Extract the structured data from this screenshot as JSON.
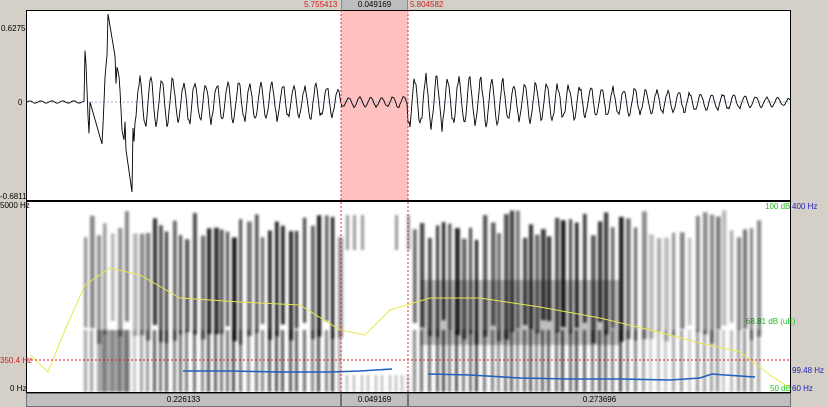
{
  "selection": {
    "start": "5.755413",
    "duration": "0.049169",
    "end": "5.804582"
  },
  "waveform": {
    "amp_max": "0.6275",
    "amp_zero": "0",
    "amp_min": "-0.6811"
  },
  "spectrogram": {
    "freq_max": "5000 Hz",
    "freq_zero": "0 Hz",
    "cursor_freq": "350.4 Hz",
    "intensity_max": "100 dB",
    "pitch_max": "400 Hz",
    "intensity_current": "68.81 dB (uE)",
    "pitch_current": "99.48 Hz",
    "intensity_min": "50 dB",
    "pitch_min": "60 Hz"
  },
  "bottom_bar": {
    "left_duration": "0.226133",
    "selection_duration": "0.049169",
    "right_duration": "0.273696"
  },
  "colors": {
    "selection_fill": "#ffc0c0",
    "selection_edge": "#e03030",
    "pitch": "#1f5fbf",
    "intensity": "#e8e850",
    "label_red": "#cc2020",
    "label_green": "#20c020",
    "label_blue": "#2020c0"
  }
}
